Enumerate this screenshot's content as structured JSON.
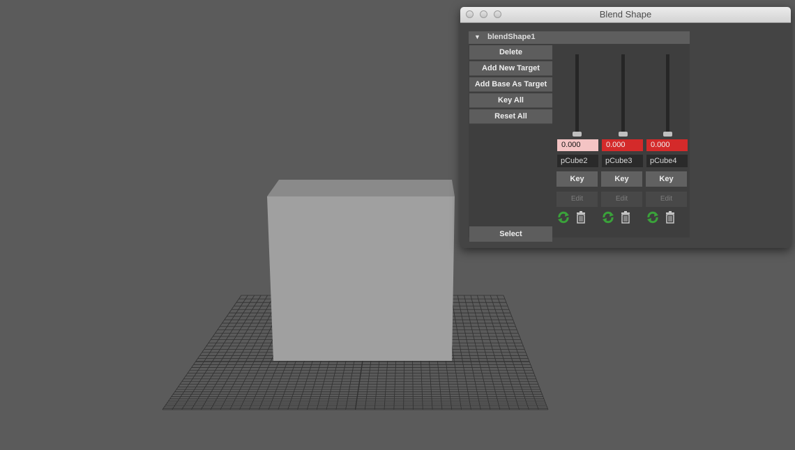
{
  "window": {
    "title": "Blend Shape"
  },
  "blend_shape": {
    "name": "blendShape1",
    "commands": [
      "Delete",
      "Add New Target",
      "Add Base As Target",
      "Key All",
      "Reset All"
    ],
    "select_label": "Select"
  },
  "targets": [
    {
      "name": "pCube2",
      "weight": "0.000",
      "key_label": "Key",
      "edit_label": "Edit",
      "field_color": "#f4c4c4",
      "field_text_color": "#111111"
    },
    {
      "name": "pCube3",
      "weight": "0.000",
      "key_label": "Key",
      "edit_label": "Edit",
      "field_color": "#d42a2a",
      "field_text_color": "#f2f2f2"
    },
    {
      "name": "pCube4",
      "weight": "0.000",
      "key_label": "Key",
      "edit_label": "Edit",
      "field_color": "#d42a2a",
      "field_text_color": "#f2f2f2"
    }
  ],
  "icons": [
    "refresh-icon",
    "trash-icon"
  ],
  "viewport": {
    "background": "#5b5b5b",
    "cube_front": "#a0a0a0",
    "cube_top": "#8a8a8a",
    "grid_color": "#303030"
  }
}
